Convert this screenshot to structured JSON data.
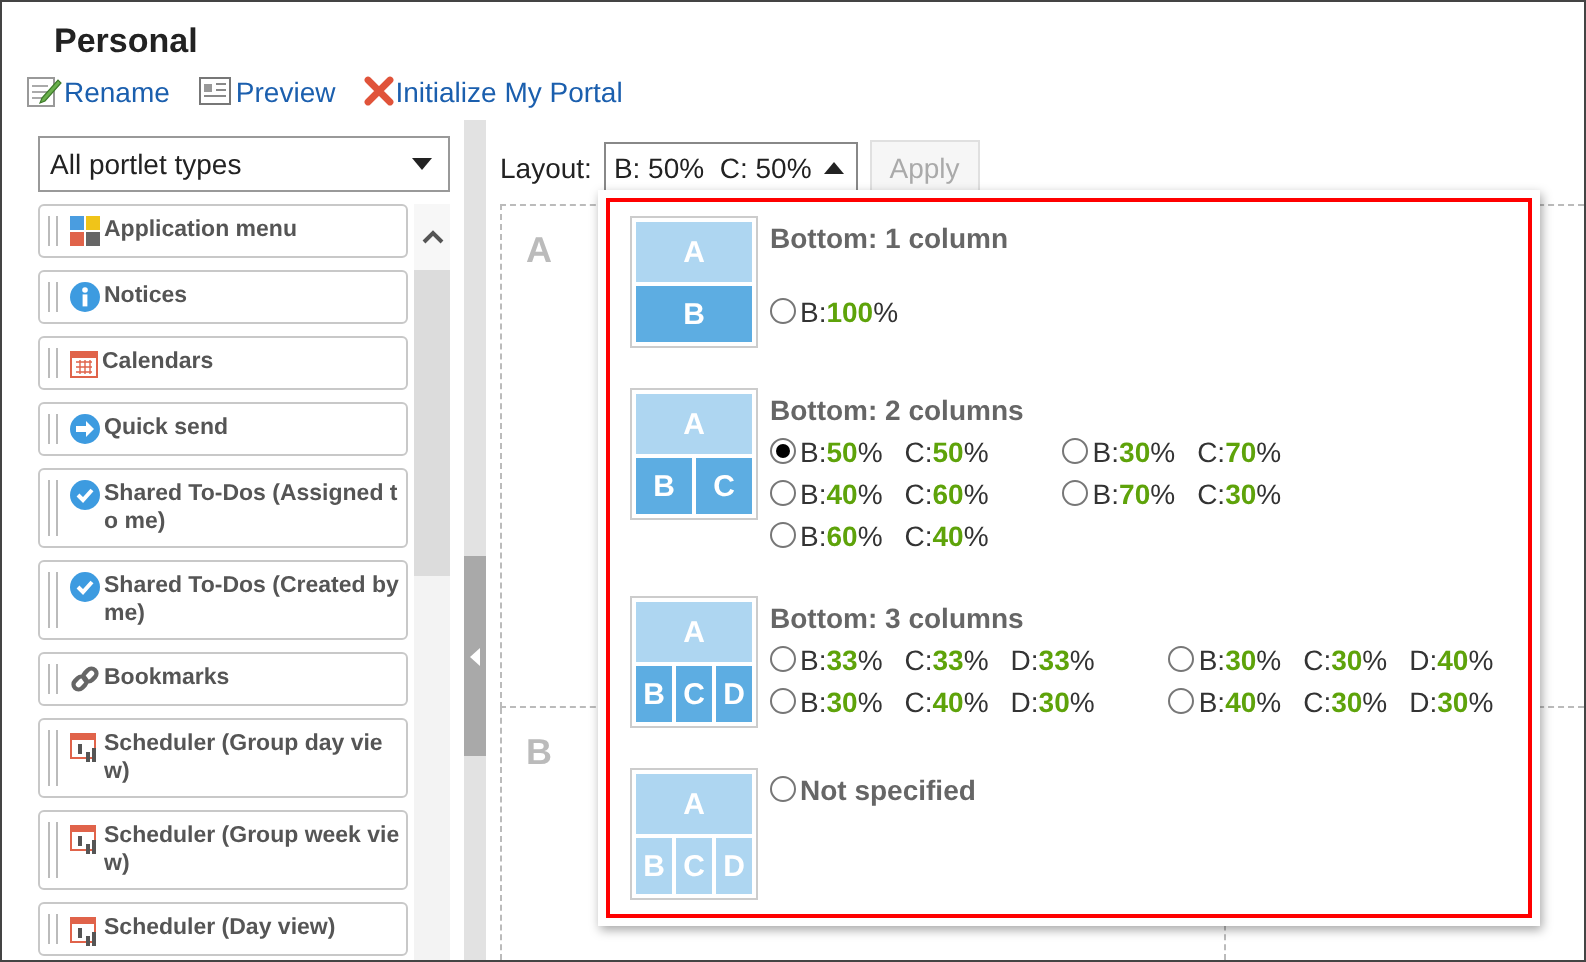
{
  "page": {
    "title": "Personal"
  },
  "toolbar": [
    {
      "label": "Rename",
      "kind": "edit"
    },
    {
      "label": "Preview",
      "kind": "preview"
    },
    {
      "label": "Initialize My Portal",
      "kind": "delete"
    }
  ],
  "portlet_filter": {
    "value": "All portlet types"
  },
  "portlets": [
    {
      "label": "Application menu",
      "kind": "apps"
    },
    {
      "label": "Notices",
      "kind": "info"
    },
    {
      "label": "Calendars",
      "kind": "calendar"
    },
    {
      "label": "Quick send",
      "kind": "arrow"
    },
    {
      "label": "Shared To-Dos (Assigned to me)",
      "kind": "todo"
    },
    {
      "label": "Shared To-Dos (Created by me)",
      "kind": "todo"
    },
    {
      "label": "Bookmarks",
      "kind": "link"
    },
    {
      "label": "Scheduler (Group day view)",
      "kind": "scheduler"
    },
    {
      "label": "Scheduler (Group week view)",
      "kind": "scheduler"
    },
    {
      "label": "Scheduler (Day view)",
      "kind": "scheduler"
    }
  ],
  "layout": {
    "label": "Layout:",
    "value": "B: 50%  C: 50%",
    "expanded": true,
    "apply": {
      "label": "Apply",
      "disabled": true
    }
  },
  "zones": [
    {
      "label": "A"
    },
    {
      "label": "B"
    }
  ],
  "layout_menu": [
    {
      "title": "Bottom: 1 column",
      "thumbnail": {
        "top": "A",
        "bottom": [
          "B"
        ],
        "dimmed": false
      },
      "options": [
        {
          "selected": false,
          "parts": [
            "B:**100**%"
          ]
        }
      ]
    },
    {
      "title": "Bottom: 2 columns",
      "thumbnail": {
        "top": "A",
        "bottom": [
          "B",
          "C"
        ],
        "dimmed": false
      },
      "options": [
        {
          "selected": true,
          "parts": [
            "B:**50**%",
            "C:**50**%"
          ]
        },
        {
          "selected": false,
          "parts": [
            "B:**30**%",
            "C:**70**%"
          ]
        },
        {
          "selected": false,
          "parts": [
            "B:**40**%",
            "C:**60**%"
          ]
        },
        {
          "selected": false,
          "parts": [
            "B:**70**%",
            "C:**30**%"
          ]
        },
        {
          "selected": false,
          "parts": [
            "B:**60**%",
            "C:**40**%"
          ]
        }
      ]
    },
    {
      "title": "Bottom: 3 columns",
      "thumbnail": {
        "top": "A",
        "bottom": [
          "B",
          "C",
          "D"
        ],
        "dimmed": false
      },
      "options": [
        {
          "selected": false,
          "parts": [
            "B:**33**%",
            "C:**33**%",
            "D:**33**%"
          ]
        },
        {
          "selected": false,
          "parts": [
            "B:**30**%",
            "C:**30**%",
            "D:**40**%"
          ]
        },
        {
          "selected": false,
          "parts": [
            "B:**30**%",
            "C:**40**%",
            "D:**30**%"
          ]
        },
        {
          "selected": false,
          "parts": [
            "B:**40**%",
            "C:**30**%",
            "D:**30**%"
          ]
        }
      ]
    },
    {
      "thumbnail": {
        "top": "A",
        "bottom": [
          "B",
          "C",
          "D"
        ],
        "dimmed": true
      },
      "options": [
        {
          "selected": false,
          "label": "Not specified"
        }
      ]
    }
  ]
}
